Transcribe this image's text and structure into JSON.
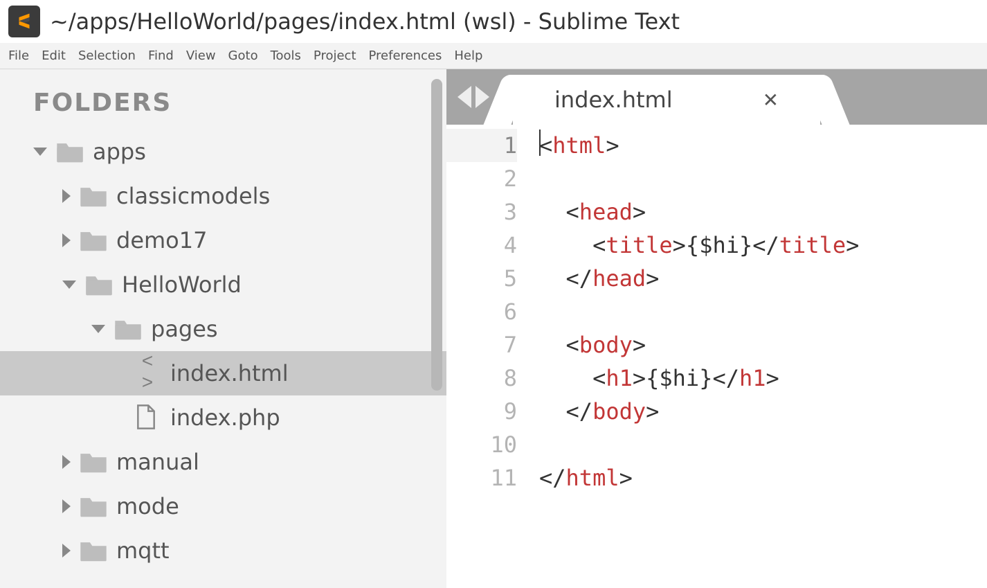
{
  "window": {
    "title": "~/apps/HelloWorld/pages/index.html (wsl) - Sublime Text"
  },
  "menubar": [
    "File",
    "Edit",
    "Selection",
    "Find",
    "View",
    "Goto",
    "Tools",
    "Project",
    "Preferences",
    "Help"
  ],
  "sidebar": {
    "heading": "FOLDERS",
    "tree": [
      {
        "name": "apps",
        "type": "folder",
        "expanded": true,
        "depth": 0,
        "children": [
          {
            "name": "classicmodels",
            "type": "folder",
            "expanded": false,
            "depth": 1
          },
          {
            "name": "demo17",
            "type": "folder",
            "expanded": false,
            "depth": 1
          },
          {
            "name": "HelloWorld",
            "type": "folder",
            "expanded": true,
            "depth": 1,
            "children": [
              {
                "name": "pages",
                "type": "folder",
                "expanded": true,
                "depth": 2,
                "children": [
                  {
                    "name": "index.html",
                    "type": "code",
                    "depth": 3,
                    "selected": true
                  },
                  {
                    "name": "index.php",
                    "type": "file",
                    "depth": 3
                  }
                ]
              }
            ]
          },
          {
            "name": "manual",
            "type": "folder",
            "expanded": false,
            "depth": 1
          },
          {
            "name": "mode",
            "type": "folder",
            "expanded": false,
            "depth": 1
          },
          {
            "name": "mqtt",
            "type": "folder",
            "expanded": false,
            "depth": 1
          }
        ]
      }
    ]
  },
  "tabs": {
    "active": {
      "label": "index.html"
    }
  },
  "editor": {
    "lines": [
      {
        "n": 1,
        "current": true,
        "segments": [
          {
            "t": "<",
            "k": "punct",
            "cursorBefore": true
          },
          {
            "t": "html",
            "k": "tagname"
          },
          {
            "t": ">",
            "k": "punct"
          }
        ]
      },
      {
        "n": 2,
        "segments": []
      },
      {
        "n": 3,
        "segments": [
          {
            "t": "  ",
            "k": "text"
          },
          {
            "t": "<",
            "k": "punct"
          },
          {
            "t": "head",
            "k": "tagname"
          },
          {
            "t": ">",
            "k": "punct"
          }
        ]
      },
      {
        "n": 4,
        "segments": [
          {
            "t": "    ",
            "k": "text"
          },
          {
            "t": "<",
            "k": "punct"
          },
          {
            "t": "title",
            "k": "tagname"
          },
          {
            "t": ">",
            "k": "punct"
          },
          {
            "t": "{$hi}",
            "k": "text"
          },
          {
            "t": "</",
            "k": "punct"
          },
          {
            "t": "title",
            "k": "tagname"
          },
          {
            "t": ">",
            "k": "punct"
          }
        ]
      },
      {
        "n": 5,
        "segments": [
          {
            "t": "  ",
            "k": "text"
          },
          {
            "t": "</",
            "k": "punct"
          },
          {
            "t": "head",
            "k": "tagname"
          },
          {
            "t": ">",
            "k": "punct"
          }
        ]
      },
      {
        "n": 6,
        "segments": []
      },
      {
        "n": 7,
        "segments": [
          {
            "t": "  ",
            "k": "text"
          },
          {
            "t": "<",
            "k": "punct"
          },
          {
            "t": "body",
            "k": "tagname"
          },
          {
            "t": ">",
            "k": "punct"
          }
        ]
      },
      {
        "n": 8,
        "segments": [
          {
            "t": "    ",
            "k": "text"
          },
          {
            "t": "<",
            "k": "punct"
          },
          {
            "t": "h1",
            "k": "tagname"
          },
          {
            "t": ">",
            "k": "punct"
          },
          {
            "t": "{$hi}",
            "k": "text"
          },
          {
            "t": "</",
            "k": "punct"
          },
          {
            "t": "h1",
            "k": "tagname"
          },
          {
            "t": ">",
            "k": "punct"
          }
        ]
      },
      {
        "n": 9,
        "segments": [
          {
            "t": "  ",
            "k": "text"
          },
          {
            "t": "</",
            "k": "punct"
          },
          {
            "t": "body",
            "k": "tagname"
          },
          {
            "t": ">",
            "k": "punct"
          }
        ]
      },
      {
        "n": 10,
        "segments": []
      },
      {
        "n": 11,
        "segments": [
          {
            "t": "</",
            "k": "punct"
          },
          {
            "t": "html",
            "k": "tagname"
          },
          {
            "t": ">",
            "k": "punct"
          }
        ]
      }
    ]
  }
}
